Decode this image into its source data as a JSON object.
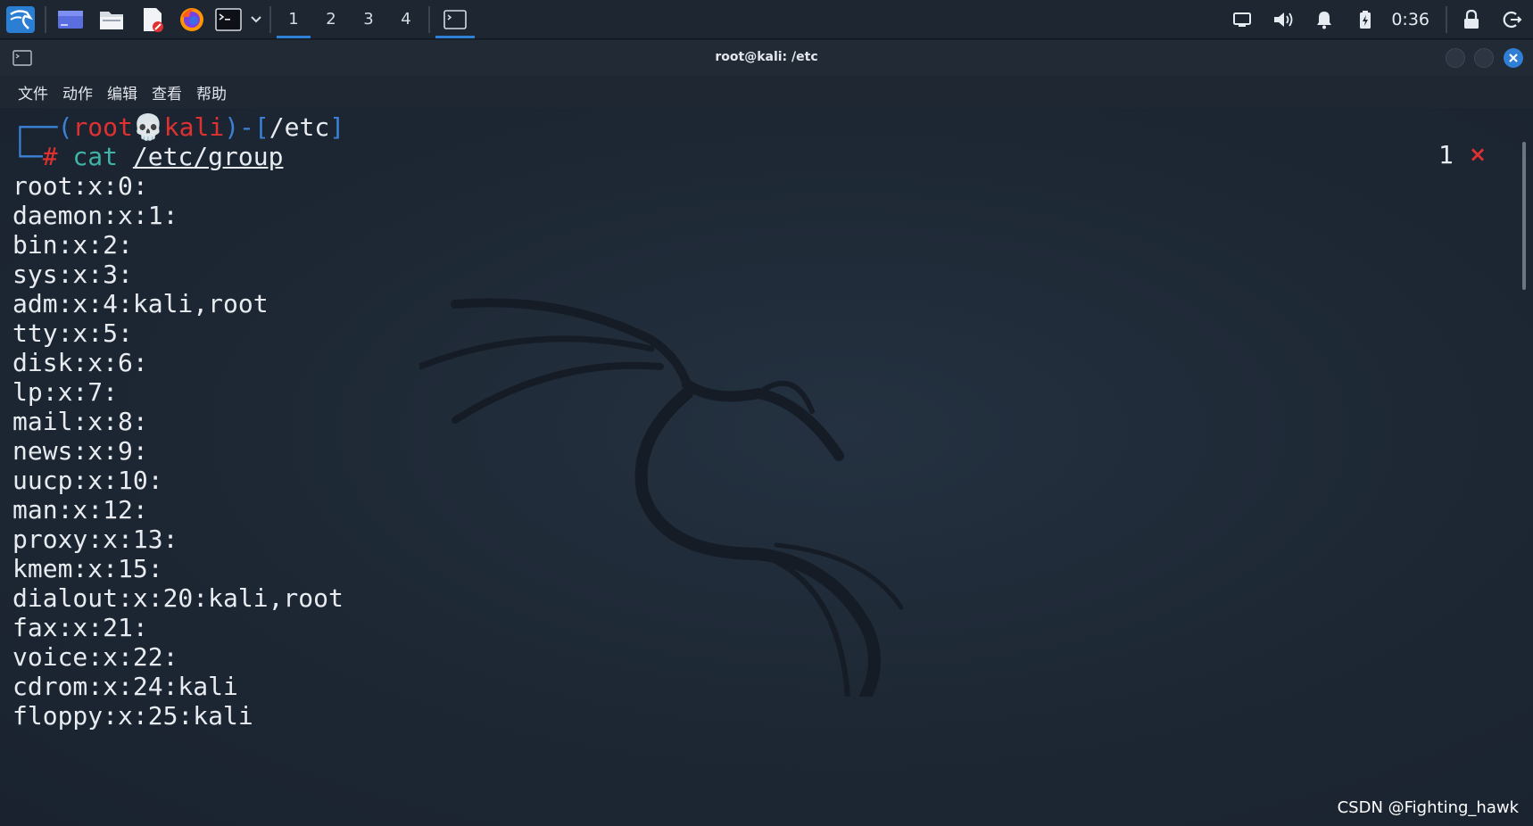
{
  "panel": {
    "workspaces": [
      "1",
      "2",
      "3",
      "4"
    ],
    "active_workspace": "1",
    "clock": "0:36"
  },
  "window": {
    "title": "root@kali: /etc",
    "menu": [
      "文件",
      "动作",
      "编辑",
      "查看",
      "帮助"
    ]
  },
  "terminal": {
    "prompt": {
      "user": "root",
      "host": "kali",
      "cwd": "/etc",
      "symbol": "#",
      "command": "cat",
      "argument": "/etc/group"
    },
    "output_lines": [
      "root:x:0:",
      "daemon:x:1:",
      "bin:x:2:",
      "sys:x:3:",
      "adm:x:4:kali,root",
      "tty:x:5:",
      "disk:x:6:",
      "lp:x:7:",
      "mail:x:8:",
      "news:x:9:",
      "uucp:x:10:",
      "man:x:12:",
      "proxy:x:13:",
      "kmem:x:15:",
      "dialout:x:20:kali,root",
      "fax:x:21:",
      "voice:x:22:",
      "cdrom:x:24:kali",
      "floppy:x:25:kali"
    ],
    "status_count": "1",
    "status_mark": "×"
  },
  "watermark": "CSDN @Fighting_hawk",
  "colors": {
    "panel_bg": "#1e2631",
    "terminal_bg": "#1d2733",
    "prompt_red": "#e03131",
    "prompt_blue": "#3b82d6",
    "command_teal": "#3fb3a7",
    "accent": "#2f7fd6"
  }
}
